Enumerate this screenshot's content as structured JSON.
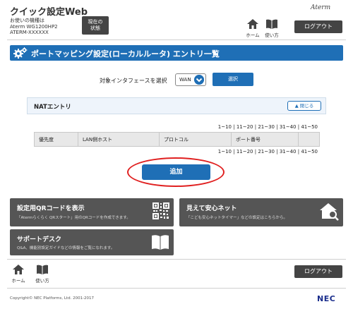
{
  "header": {
    "app_title": "クイック設定Web",
    "device_label": "お使いの機種は",
    "device_model": "Aterm WG1200HP2",
    "device_id": "ATERM-XXXXXX",
    "status_button_line1": "現在の",
    "status_button_line2": "状態",
    "home_label": "ホーム",
    "help_label": "使い方",
    "brand": "Aterm",
    "logout_label": "ログアウト"
  },
  "page": {
    "title": "ポートマッピング設定(ローカルルータ) エントリ一覧"
  },
  "interface": {
    "label": "対象インタフェースを選択",
    "selected": "WAN",
    "select_button": "選択"
  },
  "nat": {
    "title": "NATエントリ",
    "close_label": "閉じる",
    "pagination": [
      "1~10",
      "11~20",
      "21~30",
      "31~40",
      "41~50"
    ],
    "columns": [
      "優先度",
      "LAN側ホスト",
      "プロトコル",
      "ポート番号",
      ""
    ]
  },
  "add_button": "追加",
  "tiles": {
    "qr": {
      "title": "設定用QRコードを表示",
      "subtitle": "「Atermらくらく QRスタート」用のQRコードを作成できます。"
    },
    "safe": {
      "title": "見えて安心ネット",
      "subtitle": "「こども安心ネットタイマー」などの設定はこちらから。"
    },
    "support": {
      "title": "サポートデスク",
      "subtitle": "Q&A、機能別設定ガイドなどの情報をご覧になれます。"
    }
  },
  "footer": {
    "home_label": "ホーム",
    "help_label": "使い方",
    "logout_label": "ログアウト",
    "copyright": "Copyright© NEC Platforms, Ltd. 2001-2017",
    "logo": "NEC"
  },
  "colors": {
    "primary_blue": "#1f6fb6",
    "dark_button": "#444444",
    "highlight_red": "#e02020",
    "tile_gray": "#555555"
  }
}
